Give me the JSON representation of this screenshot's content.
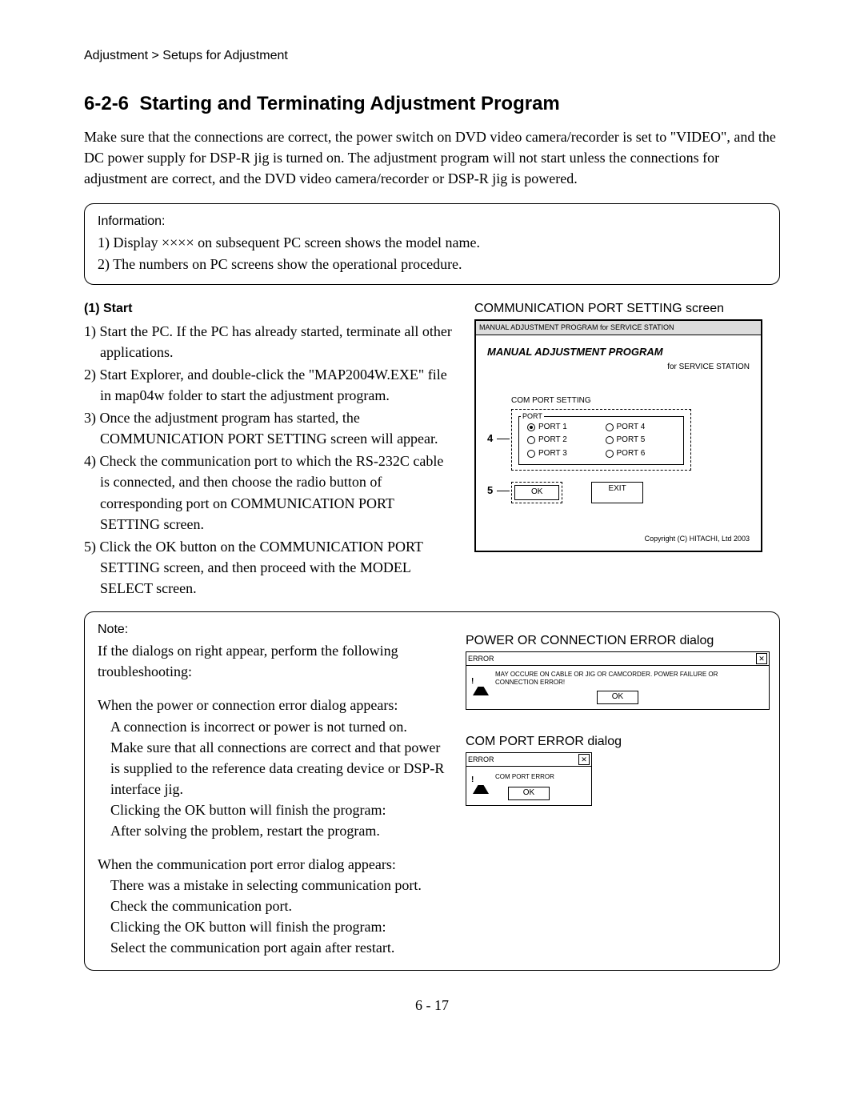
{
  "breadcrumb": "Adjustment > Setups for Adjustment",
  "section_number": "6-2-6",
  "section_title": "Starting and Terminating Adjustment Program",
  "intro": "Make sure that the connections are correct, the power switch on DVD video camera/recorder is set to \"VIDEO\", and the DC power supply for DSP-R jig is turned on. The adjustment program will not start unless the connections for adjustment are correct, and the DVD video camera/recorder or DSP-R jig is powered.",
  "info": {
    "label": "Information:",
    "line1": "1) Display ×××× on subsequent PC screen shows the model name.",
    "line2": "2) The numbers on PC screens show the operational procedure."
  },
  "start": {
    "heading": "(1)  Start",
    "s1": "1) Start the PC. If the PC has already started, terminate all other applications.",
    "s2": "2) Start Explorer, and double-click the \"MAP2004W.EXE\" file in map04w folder to start the adjustment program.",
    "s3": "3) Once the adjustment program has started, the COMMUNICATION PORT SETTING screen will appear.",
    "s4": "4) Check the communication port to which the RS-232C cable is connected, and then choose the radio button of corresponding port on COMMUNICATION PORT SETTING screen.",
    "s5": "5) Click the OK button on the COMMUNICATION PORT SETTING screen, and then proceed with the MODEL SELECT screen."
  },
  "comm_screen": {
    "caption": "COMMUNICATION PORT SETTING screen",
    "titlebar": "MANUAL ADJUSTMENT PROGRAM for SERVICE STATION",
    "program_title": "MANUAL ADJUSTMENT PROGRAM",
    "program_sub": "for SERVICE STATION",
    "section_label": "COM PORT SETTING",
    "fieldset_legend": "PORT",
    "ports": {
      "p1": "PORT 1",
      "p2": "PORT 2",
      "p3": "PORT 3",
      "p4": "PORT 4",
      "p5": "PORT 5",
      "p6": "PORT 6"
    },
    "ok": "OK",
    "exit": "EXIT",
    "callout4": "4",
    "callout5": "5",
    "copyright": "Copyright (C) HITACHI, Ltd  2003"
  },
  "note": {
    "label": "Note:",
    "intro": "If the dialogs on right appear, perform the following troubleshooting:",
    "power_heading": "When the power or connection error dialog appears:",
    "power_l1": "A connection is incorrect or power is not turned on.",
    "power_l2": "Make sure that all connections are correct and that power is supplied to the reference data creating device or DSP-R interface jig.",
    "power_l3": "Clicking the OK button will finish the program:",
    "power_l4": "After solving the problem, restart the program.",
    "com_heading": "When the communication port error dialog appears:",
    "com_l1": "There was a mistake in selecting communication port.",
    "com_l2": "Check the communication port.",
    "com_l3": "Clicking the OK button will finish the program:",
    "com_l4": "Select the communication port again after restart."
  },
  "err1": {
    "caption": "POWER OR CONNECTION ERROR dialog",
    "title": "ERROR",
    "msg": "MAY OCCURE ON CABLE OR JIG OR CAMCORDER. POWER FAILURE OR CONNECTION ERROR!",
    "ok": "OK"
  },
  "err2": {
    "caption": "COM PORT ERROR dialog",
    "title": "ERROR",
    "msg": "COM PORT ERROR",
    "ok": "OK"
  },
  "page_number": "6 - 17"
}
